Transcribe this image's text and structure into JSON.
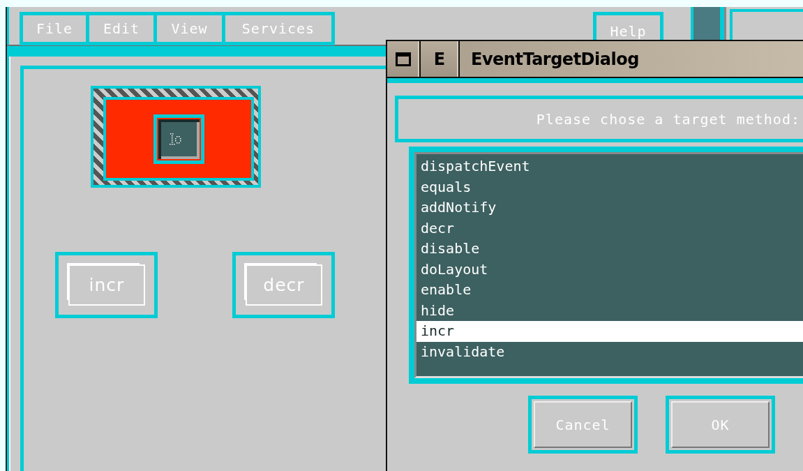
{
  "main_window": {
    "menu_bar": [
      {
        "label": "File"
      },
      {
        "label": "Edit"
      },
      {
        "label": "View"
      },
      {
        "label": "Services"
      }
    ],
    "help_menu": {
      "label": "Help"
    },
    "canvas": {
      "buttons": [
        {
          "label": "incr"
        },
        {
          "label": "decr"
        }
      ]
    }
  },
  "dialog": {
    "title": "EventTargetDialog",
    "menu_button": "E",
    "prompt": "Please chose a target method:",
    "methods": [
      {
        "label": "dispatchEvent",
        "selected": false
      },
      {
        "label": "equals",
        "selected": false
      },
      {
        "label": "addNotify",
        "selected": false
      },
      {
        "label": "decr",
        "selected": false
      },
      {
        "label": "disable",
        "selected": false
      },
      {
        "label": "doLayout",
        "selected": false
      },
      {
        "label": "enable",
        "selected": false
      },
      {
        "label": "hide",
        "selected": false
      },
      {
        "label": "incr",
        "selected": true
      },
      {
        "label": "invalidate",
        "selected": false
      }
    ],
    "buttons": [
      {
        "label": "Cancel"
      },
      {
        "label": "OK"
      }
    ]
  }
}
